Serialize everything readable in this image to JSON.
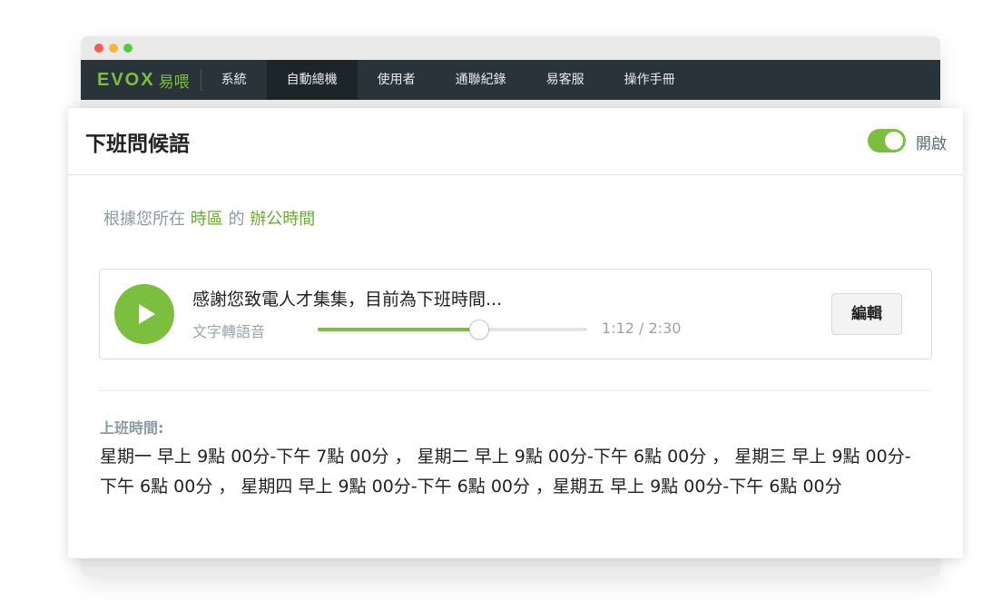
{
  "nav": {
    "logo_en": "EVOX",
    "logo_zh": "易喂",
    "items": [
      {
        "label": "系統",
        "active": false
      },
      {
        "label": "自動總機",
        "active": true
      },
      {
        "label": "使用者",
        "active": false
      },
      {
        "label": "通聯紀錄",
        "active": false
      },
      {
        "label": "易客服",
        "active": false
      },
      {
        "label": "操作手冊",
        "active": false
      }
    ]
  },
  "card": {
    "title": "下班問候語",
    "toggle_label": "開啟",
    "toggle_on": true
  },
  "subtitle": {
    "prefix": "根據您所在",
    "timezone": "時區",
    "middle": "的",
    "office_hours": "辦公時間"
  },
  "player": {
    "message": "感謝您致電人才集集，目前為下班時間...",
    "tts_label": "文字轉語音",
    "time": "1:12 / 2:30",
    "progress": 0.6,
    "edit_label": "編輯"
  },
  "hours": {
    "label": "上班時間:",
    "text": "星期一 早上 9點 00分-下午 7點 00分 ， 星期二 早上 9點 00分-下午 6點 00分 ， 星期三 早上 9點 00分-下午 6點 00分 ， 星期四 早上 9點 00分-下午 6點 00分 ，星期五 早上 9點 00分-下午 6點 00分"
  },
  "colors": {
    "accent": "#7cbf3f",
    "navbar": "#28333a"
  }
}
